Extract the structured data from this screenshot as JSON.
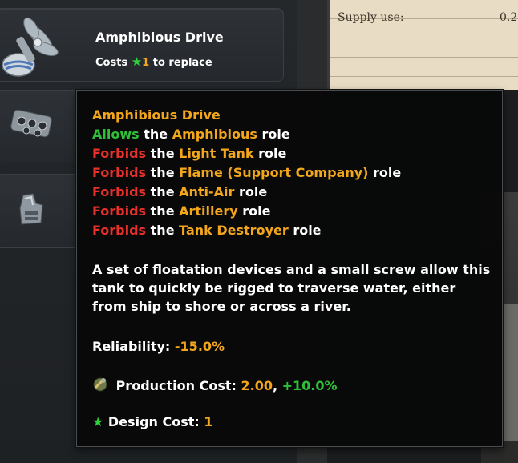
{
  "slots": [
    {
      "title": "Amphibious Drive",
      "cost_prefix": "Costs",
      "cost_star": "★",
      "cost_value": "1",
      "cost_suffix": "to replace",
      "icon": "propeller-icon"
    },
    {
      "icon": "engine-block-icon"
    },
    {
      "icon": "turret-part-icon"
    }
  ],
  "paper": {
    "label": "Supply use:",
    "value": "0.2"
  },
  "tooltip": {
    "title": "Amphibious Drive",
    "allows": {
      "verb": "Allows",
      "the": "the",
      "role": "Amphibious",
      "suffix": "role"
    },
    "forbids": [
      {
        "verb": "Forbids",
        "the": "the",
        "role": "Light Tank",
        "suffix": "role"
      },
      {
        "verb": "Forbids",
        "the": "the",
        "role": "Flame (Support Company)",
        "suffix": "role"
      },
      {
        "verb": "Forbids",
        "the": "the",
        "role": "Anti-Air",
        "suffix": "role"
      },
      {
        "verb": "Forbids",
        "the": "the",
        "role": "Artillery",
        "suffix": "role"
      },
      {
        "verb": "Forbids",
        "the": "the",
        "role": "Tank Destroyer",
        "suffix": "role"
      }
    ],
    "description": "A set of floatation devices and a small screw allow this tank to quickly be rigged to traverse water, either from ship to shore or across a river.",
    "reliability_label": "Reliability:",
    "reliability_value": "-15.0%",
    "production_label": "Production Cost:",
    "production_value": "2.00",
    "production_sep": ",",
    "production_delta": "+10.0%",
    "design_star": "★",
    "design_label": "Design Cost:",
    "design_value": "1"
  },
  "colors": {
    "orange": "#f2a61c",
    "green": "#2fc038",
    "red": "#e6302b"
  }
}
